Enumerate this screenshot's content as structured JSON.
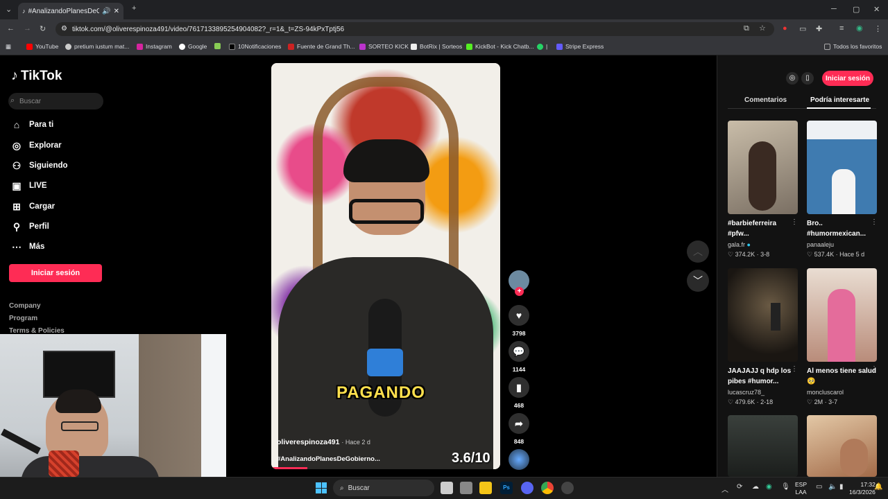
{
  "browser": {
    "tab_title": "#AnalizandoPlanesDeGobie...",
    "new_tab_icon": "plus-icon",
    "url": "tiktok.com/@oliverespinoza491/video/7617133895254904082?_r=1&_t=ZS-94kPxTptj56",
    "bookmarks": [
      "YouTube",
      "pretium iustum mat...",
      "Instagram",
      "Google",
      "",
      "10Notificaciones",
      "Fuente de Grand Th...",
      "SORTEO KICK",
      "BotRix | Sorteos",
      "KickBot - Kick Chatb...",
      "|",
      "Stripe Express"
    ],
    "all_bookmarks": "Todos los favoritos"
  },
  "sidebar": {
    "logo": "TikTok",
    "search_placeholder": "Buscar",
    "nav": [
      {
        "label": "Para ti",
        "icon": "home-icon"
      },
      {
        "label": "Explorar",
        "icon": "compass-icon"
      },
      {
        "label": "Siguiendo",
        "icon": "following-icon"
      },
      {
        "label": "LIVE",
        "icon": "live-icon"
      },
      {
        "label": "Cargar",
        "icon": "upload-icon"
      },
      {
        "label": "Perfil",
        "icon": "profile-icon"
      },
      {
        "label": "Más",
        "icon": "more-icon"
      }
    ],
    "login_label": "Iniciar sesión",
    "footer": [
      "Company",
      "Program",
      "Terms & Policies"
    ]
  },
  "video": {
    "caption": "PAGANDO",
    "author": "oliverespinoza491",
    "time": "· Hace 2 d",
    "hashtag": "#AnalizandoPlanesDeGobierno...",
    "score": "3.6/10",
    "likes": "3798",
    "comments": "1144",
    "saves": "468",
    "shares": "848"
  },
  "right_panel": {
    "login_label": "Iniciar sesión",
    "tabs": [
      "Comentarios",
      "Podría interesarte"
    ],
    "cards": [
      {
        "title": "#barbieferreira #pfw...",
        "author": "gala.fr",
        "likes": "374.2K",
        "date": "3-8",
        "thumb": "#a89c8d"
      },
      {
        "title": "Bro.. #humormexican...",
        "author": "panaaleju",
        "likes": "537.4K",
        "date": "Hace 5 d",
        "thumb": "#3a6e9c"
      },
      {
        "title": "JAAJAJJ q hdp los pibes #humor...",
        "author": "lucascruz78_",
        "likes": "479.6K",
        "date": "2-18",
        "thumb": "#2a2622"
      },
      {
        "title": "Al menos tiene salud 🥺",
        "author": "moncluscarol",
        "likes": "2M",
        "date": "3-7",
        "thumb": "#c98a8a"
      },
      {
        "title": "",
        "author": "",
        "likes": "",
        "date": "",
        "thumb": "#2e3430"
      },
      {
        "title": "",
        "author": "",
        "likes": "",
        "date": "",
        "thumb": "#c7a07a"
      }
    ]
  },
  "taskbar": {
    "search_placeholder": "Buscar",
    "lang_top": "ESP",
    "lang_bottom": "LAA",
    "time": "17:32",
    "date": "16/3/2026"
  },
  "colors": {
    "accent": "#fe2c55",
    "caption": "#ffe04d"
  }
}
